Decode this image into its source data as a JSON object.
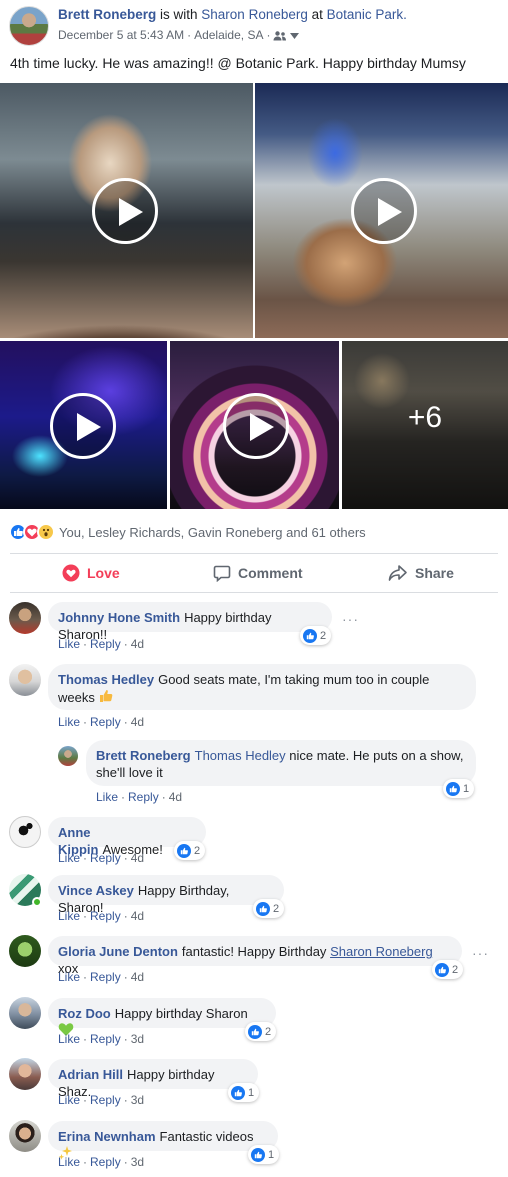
{
  "post": {
    "author": "Brett Roneberg",
    "with_text": " is with ",
    "tagged": "Sharon Roneberg",
    "at_text": " at ",
    "place": "Botanic Park.",
    "date": "December 5 at 5:43 AM",
    "location": "Adelaide, SA",
    "separator": "·",
    "text": "4th time lucky. He was amazing!! @ Botanic Park. Happy birthday Mumsy",
    "more_media": "+6"
  },
  "reactions": {
    "summary": "You, Lesley Richards, Gavin Roneberg and 61 others"
  },
  "actions": {
    "love": "Love",
    "comment": "Comment",
    "share": "Share"
  },
  "comments": [
    {
      "name": "Johnny Hone Smith",
      "text": "Happy birthday Sharon!!",
      "like": "Like",
      "reply": "Reply",
      "time": "4d",
      "count": "2"
    },
    {
      "name": "Thomas Hedley",
      "text": "Good seats mate, I'm taking mum too in couple weeks",
      "like": "Like",
      "reply": "Reply",
      "time": "4d"
    },
    {
      "name": "Brett Roneberg",
      "tag": "Thomas Hedley",
      "text": "nice mate. He puts on a show, she'll love it",
      "like": "Like",
      "reply": "Reply",
      "time": "4d",
      "count": "1"
    },
    {
      "name": "Anne Kippin",
      "text": "Awesome!",
      "like": "Like",
      "reply": "Reply",
      "time": "4d",
      "count": "2"
    },
    {
      "name": "Vince Askey",
      "text": "Happy Birthday, Sharon!",
      "like": "Like",
      "reply": "Reply",
      "time": "4d",
      "count": "2"
    },
    {
      "name": "Gloria June Denton",
      "text": "fantastic! Happy Birthday",
      "tag": "Sharon Roneberg",
      "text2": "xox",
      "like": "Like",
      "reply": "Reply",
      "time": "4d",
      "count": "2"
    },
    {
      "name": "Roz Doo",
      "text": "Happy birthday Sharon",
      "like": "Like",
      "reply": "Reply",
      "time": "3d",
      "count": "2"
    },
    {
      "name": "Adrian Hill",
      "text": "Happy birthday Shaz.",
      "like": "Like",
      "reply": "Reply",
      "time": "3d",
      "count": "1"
    },
    {
      "name": "Erina Newnham",
      "text": "Fantastic videos",
      "like": "Like",
      "reply": "Reply",
      "time": "3d",
      "count": "1"
    }
  ],
  "colors": {
    "link": "#385898",
    "love": "#f33e58",
    "like": "#1877f2",
    "bubble": "#f2f3f5",
    "meta": "#606770"
  },
  "icons": [
    "play-icon",
    "like-reaction-icon",
    "love-reaction-icon",
    "wow-reaction-icon",
    "heart-outline-icon",
    "comment-icon",
    "share-icon",
    "friends-privacy-icon",
    "chevron-down-icon",
    "more-options-icon",
    "thumbs-up-emoji",
    "green-heart-emoji",
    "sparkles-emoji"
  ]
}
